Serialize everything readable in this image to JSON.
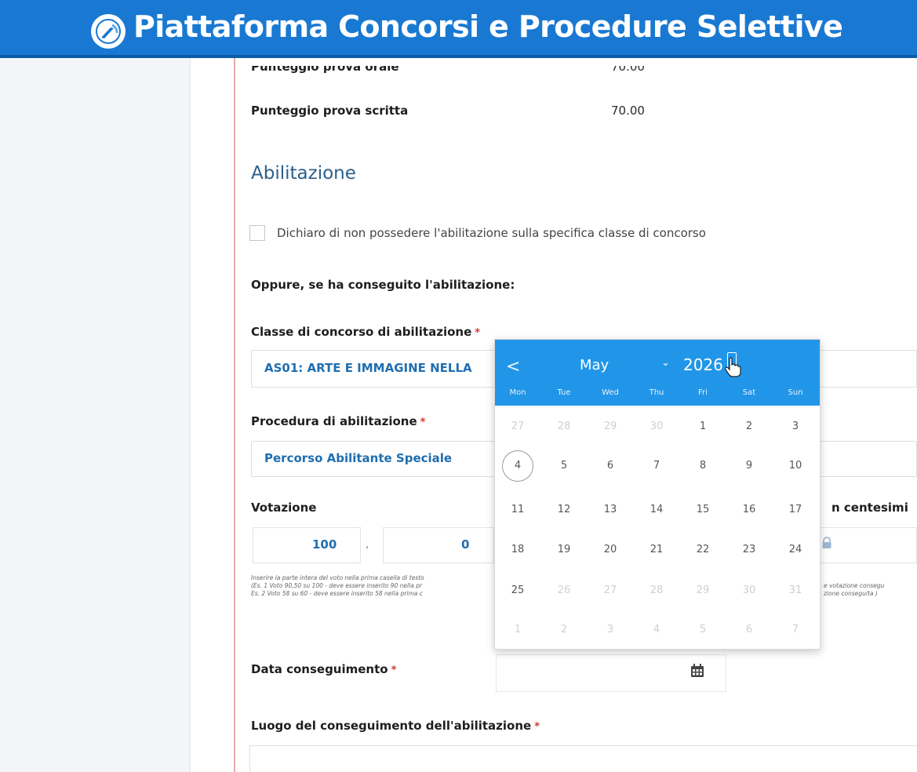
{
  "banner": {
    "title": "Piattaforma Concorsi e Procedure Selettive"
  },
  "scores": {
    "oral_label": "Punteggio prova orale",
    "oral_value": "70.00",
    "written_label": "Punteggio prova scritta",
    "written_value": "70.00"
  },
  "section": {
    "title": "Abilitazione"
  },
  "declaration": {
    "label": "Dichiaro di non possedere l'abilitazione sulla specifica classe di concorso"
  },
  "alternative": {
    "label": "Oppure, se ha conseguito l'abilitazione:"
  },
  "classe": {
    "label": "Classe di concorso di abilitazione",
    "value": "AS01: ARTE E IMMAGINE NELLA"
  },
  "procedura": {
    "label": "Procedura di abilitazione",
    "value": "Percorso Abilitante Speciale"
  },
  "votazione": {
    "label": "Votazione",
    "right_label": "n centesimi",
    "integer_value": "100",
    "separator": ",",
    "decimal_value": "0",
    "hint_lines": [
      "Inserire la parte intera del voto nella prima casella di testo",
      "(Es. 1 Voto 90,50 su 100 - deve essere inserito 90 nella pr",
      "Es. 2 Voto 58 su 60 - deve essere inserito 58 nella prima c"
    ],
    "hint_right_lines": [
      "e votazione consegu",
      "zione conseguita )"
    ]
  },
  "data_conseguimento": {
    "label": "Data conseguimento"
  },
  "luogo": {
    "label": "Luogo del conseguimento dell'abilitazione"
  },
  "required_mark": "*",
  "datepicker": {
    "prev": "<",
    "month": "May",
    "year": "2026",
    "weekdays": [
      "Mon",
      "Tue",
      "Wed",
      "Thu",
      "Fri",
      "Sat",
      "Sun"
    ],
    "weeks": [
      [
        "27",
        "28",
        "29",
        "30",
        "1",
        "2",
        "3"
      ],
      [
        "4",
        "5",
        "6",
        "7",
        "8",
        "9",
        "10"
      ],
      [
        "11",
        "12",
        "13",
        "14",
        "15",
        "16",
        "17"
      ],
      [
        "18",
        "19",
        "20",
        "21",
        "22",
        "23",
        "24"
      ],
      [
        "25",
        "26",
        "27",
        "28",
        "29",
        "30",
        "31"
      ],
      [
        "1",
        "2",
        "3",
        "4",
        "5",
        "6",
        "7"
      ]
    ],
    "today": "4"
  },
  "colors": {
    "banner": "#1979d2",
    "accent": "#2196e8",
    "field_text": "#1f6eb0",
    "required": "#d3382f"
  }
}
